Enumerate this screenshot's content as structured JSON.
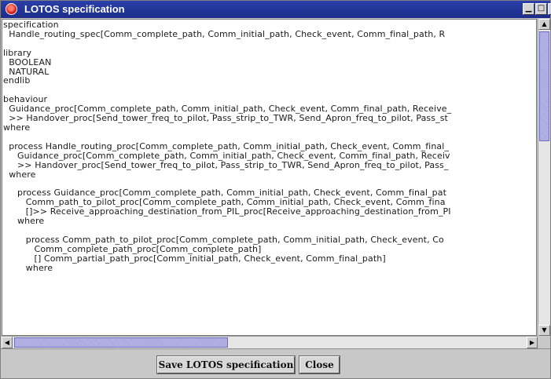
{
  "window": {
    "title": "LOTOS specification",
    "minimize_glyph": "▁",
    "maximize_glyph": "□",
    "close_glyph": "x"
  },
  "editor": {
    "lines": [
      "specification",
      "  Handle_routing_spec[Comm_complete_path, Comm_initial_path, Check_event, Comm_final_path, R",
      "",
      "library",
      "  BOOLEAN",
      "  NATURAL",
      "endlib",
      "",
      "behaviour",
      "  Guidance_proc[Comm_complete_path, Comm_initial_path, Check_event, Comm_final_path, Receive_",
      "  >> Handover_proc[Send_tower_freq_to_pilot, Pass_strip_to_TWR, Send_Apron_freq_to_pilot, Pass_st",
      "where",
      "",
      "  process Handle_routing_proc[Comm_complete_path, Comm_initial_path, Check_event, Comm_final_",
      "     Guidance_proc[Comm_complete_path, Comm_initial_path, Check_event, Comm_final_path, Receiv",
      "     >> Handover_proc[Send_tower_freq_to_pilot, Pass_strip_to_TWR, Send_Apron_freq_to_pilot, Pass_",
      "  where",
      "",
      "     process Guidance_proc[Comm_complete_path, Comm_initial_path, Check_event, Comm_final_pat",
      "        Comm_path_to_pilot_proc[Comm_complete_path, Comm_initial_path, Check_event, Comm_fina",
      "        []>> Receive_approaching_destination_from_PIL_proc[Receive_approaching_destination_from_PI",
      "     where",
      "",
      "        process Comm_path_to_pilot_proc[Comm_complete_path, Comm_initial_path, Check_event, Co",
      "           Comm_complete_path_proc[Comm_complete_path]",
      "           [] Comm_partial_path_proc[Comm_initial_path, Check_event, Comm_final_path]",
      "        where"
    ]
  },
  "scrollbars": {
    "up_arrow": "▲",
    "down_arrow": "▼",
    "left_arrow": "◀",
    "right_arrow": "▶"
  },
  "buttons": {
    "save_label": "Save LOTOS specification",
    "close_label": "Close"
  },
  "colors": {
    "titlebar": "#2a3fa8",
    "scroll_thumb": "#b0b0e0",
    "background": "#c8c8c8"
  }
}
